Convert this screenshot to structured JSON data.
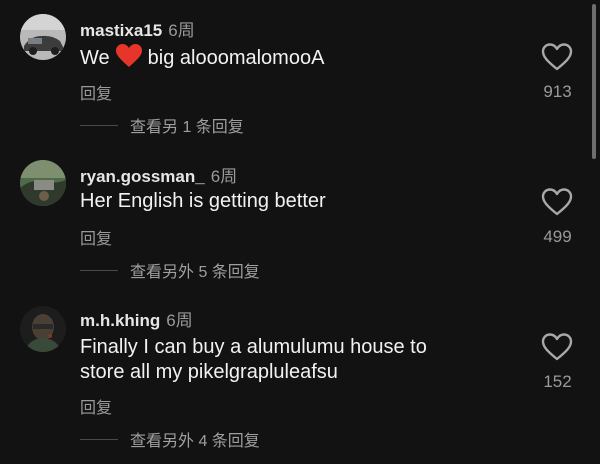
{
  "comments": [
    {
      "username": "mastixa15",
      "age": "6周",
      "text_before": "We",
      "text_after": "big alooomalomooA",
      "reply_label": "回复",
      "likes": "913",
      "view_replies": "查看另 1 条回复"
    },
    {
      "username": "ryan.gossman_",
      "age": "6周",
      "text": "Her English is getting better",
      "reply_label": "回复",
      "likes": "499",
      "view_replies": "查看另外 5 条回复"
    },
    {
      "username": "m.h.khing",
      "age": "6周",
      "text_line1": "Finally I can buy a alumulumu house to",
      "text_line2": "store all my pikelgrapluleafsu",
      "reply_label": "回复",
      "likes": "152",
      "view_replies": "查看另外 4 条回复"
    }
  ],
  "colors": {
    "background": "#121212",
    "heart_emoji": "#e8352b",
    "secondary_text": "#9a9a9a"
  },
  "icons": {
    "like": "heart-outline-icon",
    "emoji": "red-heart-emoji"
  }
}
